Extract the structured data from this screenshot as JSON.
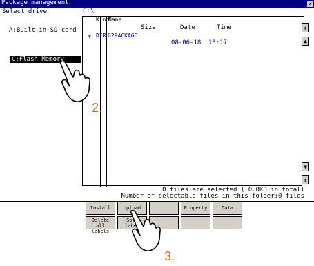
{
  "window": {
    "title": "Package management",
    "close_icon": "×"
  },
  "left_panel": {
    "select_label": "Select drive",
    "drives": [
      "A:Built-in SD card",
      "C:Flash Memory"
    ],
    "selected": "C:Flash Memory"
  },
  "path": "C:\\",
  "file_list": {
    "headers": {
      "kind": "Kind",
      "name": "Name",
      "size": "Size",
      "date": "Date",
      "time": "Time"
    },
    "rows": [
      {
        "marker": "*",
        "kind": "DIR",
        "name": "G2PACKAGE",
        "date": "08-06-18",
        "time": "13:17"
      }
    ]
  },
  "scroll_icons": {
    "top": "⇞",
    "up": "▲",
    "down": "▼",
    "bottom": "⇟"
  },
  "status": {
    "line1": "0 files are selected (   0.0KB in total)",
    "line2": "Number of selectable files in this folder:0 files"
  },
  "buttons": {
    "install": "Install",
    "upload": "Upload",
    "property": "Property",
    "data_check": "Data check",
    "delete_all_labels": [
      "Delete",
      "all labels"
    ],
    "sort_labels": [
      "Sort",
      "label"
    ]
  },
  "annotations": {
    "step2": "2.",
    "step3": "3."
  },
  "colors": {
    "titlebar": "#000080",
    "accent": "#e07820",
    "list_text": "#0000c0",
    "button": "#d4d0c8"
  }
}
